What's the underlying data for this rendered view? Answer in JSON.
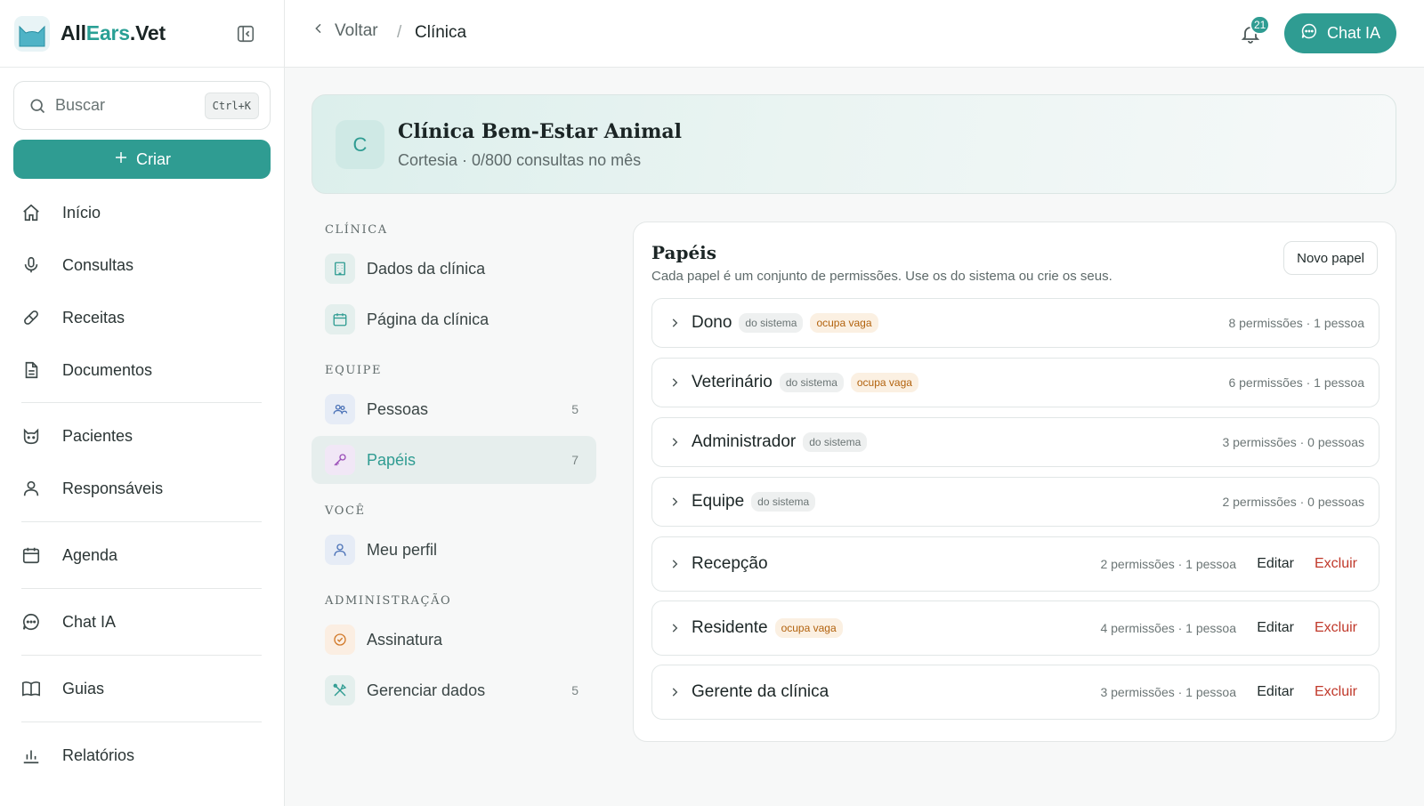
{
  "brand": {
    "part1": "All",
    "part2": "Ears",
    "part3": ".Vet"
  },
  "search": {
    "placeholder": "Buscar",
    "shortcut": "Ctrl+K"
  },
  "create_label": "Criar",
  "nav": [
    {
      "label": "Início",
      "icon": "home-icon"
    },
    {
      "label": "Consultas",
      "icon": "microphone-icon"
    },
    {
      "label": "Receitas",
      "icon": "pill-icon"
    },
    {
      "label": "Documentos",
      "icon": "document-icon"
    },
    {
      "label": "Pacientes",
      "icon": "cat-icon"
    },
    {
      "label": "Responsáveis",
      "icon": "user-icon"
    },
    {
      "label": "Agenda",
      "icon": "calendar-icon"
    },
    {
      "label": "Chat IA",
      "icon": "chat-icon"
    },
    {
      "label": "Guias",
      "icon": "book-icon"
    },
    {
      "label": "Relatórios",
      "icon": "bar-chart-icon"
    }
  ],
  "topbar": {
    "back_label": "Voltar",
    "separator": "/",
    "current": "Clínica",
    "notifications_count": "21",
    "chat_label": "Chat IA"
  },
  "clinic": {
    "initial": "C",
    "name": "Clínica Bem-Estar Animal",
    "subtitle": "Cortesia · 0/800 consultas no mês"
  },
  "settings_menu": {
    "sections": [
      {
        "heading": "CLÍNICA"
      },
      {
        "heading": "EQUIPE"
      },
      {
        "heading": "VOCÊ"
      },
      {
        "heading": "ADMINISTRAÇÃO"
      }
    ],
    "items": [
      {
        "label": "Dados da clínica",
        "icon": "building-icon",
        "count": ""
      },
      {
        "label": "Página da clínica",
        "icon": "calendar-page-icon",
        "count": ""
      },
      {
        "label": "Pessoas",
        "icon": "people-icon",
        "count": "5"
      },
      {
        "label": "Papéis",
        "icon": "key-icon",
        "count": "7"
      },
      {
        "label": "Meu perfil",
        "icon": "profile-icon",
        "count": ""
      },
      {
        "label": "Assinatura",
        "icon": "badge-check-icon",
        "count": ""
      },
      {
        "label": "Gerenciar dados",
        "icon": "tools-icon",
        "count": "5"
      }
    ],
    "active": "Papéis"
  },
  "roles": {
    "title": "Papéis",
    "description": "Cada papel é um conjunto de permissões. Use os do sistema ou crie os seus.",
    "new_label": "Novo papel",
    "edit_label": "Editar",
    "delete_label": "Excluir",
    "system_tag": "do sistema",
    "seat_tag": "ocupa vaga",
    "items": [
      {
        "name": "Dono",
        "meta": "8 permissões · 1 pessoa"
      },
      {
        "name": "Veterinário",
        "meta": "6 permissões · 1 pessoa"
      },
      {
        "name": "Administrador",
        "meta": "3 permissões · 0 pessoas"
      },
      {
        "name": "Equipe",
        "meta": "2 permissões · 0 pessoas"
      },
      {
        "name": "Recepção",
        "meta": "2 permissões · 1 pessoa"
      },
      {
        "name": "Residente",
        "meta": "4 permissões · 1 pessoa"
      },
      {
        "name": "Gerente da clínica",
        "meta": "3 permissões · 1 pessoa"
      }
    ]
  },
  "colors": {
    "accent": "#2f9c92",
    "danger": "#c0392b",
    "seat_tag_bg": "#fbf0e2",
    "seat_tag_text": "#b2620d"
  }
}
